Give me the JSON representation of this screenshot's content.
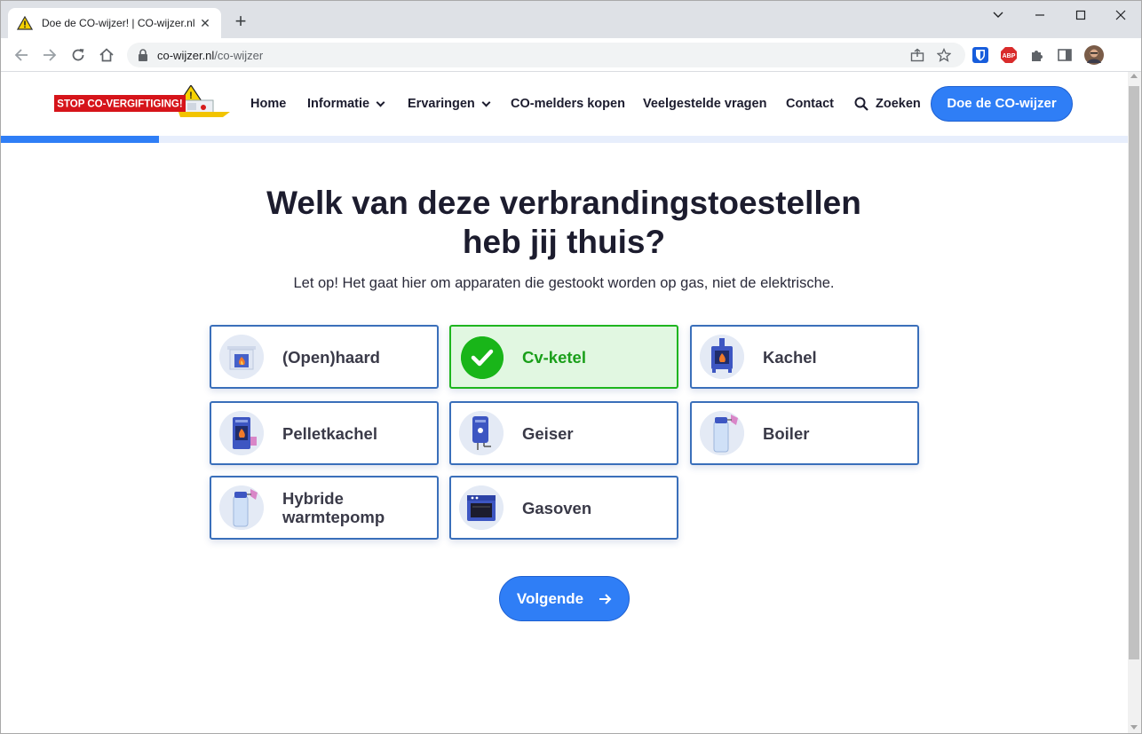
{
  "browser": {
    "tab_title": "Doe de CO-wijzer! | CO-wijzer.nl",
    "url_host": "co-wijzer.nl",
    "url_path": "/co-wijzer"
  },
  "site": {
    "logo_text": "STOP CO-VERGIFTIGING!",
    "nav": {
      "home": "Home",
      "informatie": "Informatie",
      "ervaringen": "Ervaringen",
      "co_melders": "CO-melders kopen",
      "faq": "Veelgestelde vragen",
      "contact": "Contact",
      "zoeken": "Zoeken"
    },
    "cta": "Doe de CO-wijzer",
    "progress": 0.14
  },
  "quiz": {
    "heading_line1": "Welk van deze verbrandingstoestellen",
    "heading_line2": "heb jij thuis?",
    "subtext": "Let op! Het gaat hier om apparaten die gestookt worden op gas, niet de elektrische.",
    "options": [
      {
        "label": "(Open)haard",
        "icon": "fireplace-icon",
        "selected": false
      },
      {
        "label": "Cv-ketel",
        "icon": "checkmark-icon",
        "selected": true
      },
      {
        "label": "Kachel",
        "icon": "stove-icon",
        "selected": false
      },
      {
        "label": "Pelletkachel",
        "icon": "pellet-stove-icon",
        "selected": false
      },
      {
        "label": "Geiser",
        "icon": "geyser-icon",
        "selected": false
      },
      {
        "label": "Boiler",
        "icon": "boiler-icon",
        "selected": false
      },
      {
        "label": "Hybride warmtepomp",
        "label_line1": "Hybride",
        "label_line2": "warmtepomp",
        "icon": "heat-pump-icon",
        "selected": false
      },
      {
        "label": "Gasoven",
        "icon": "gas-oven-icon",
        "selected": false
      }
    ],
    "next_label": "Volgende"
  },
  "colors": {
    "accent": "#2f7ef6",
    "selected_border": "#1eb51e",
    "selected_bg": "#e1f7e1",
    "option_border": "#3a6fba"
  }
}
